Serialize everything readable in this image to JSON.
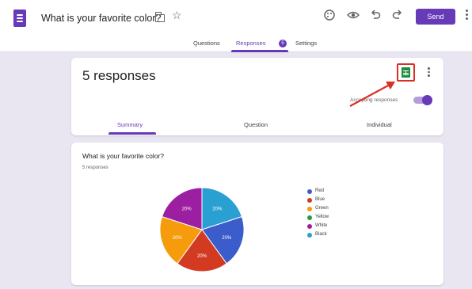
{
  "header": {
    "form_title": "What is your favorite color?",
    "icons": [
      "folder-icon",
      "star-icon",
      "palette-icon",
      "preview-eye-icon",
      "undo-icon",
      "redo-icon",
      "more-vert-icon"
    ],
    "send_label": "Send"
  },
  "tabs": [
    {
      "label": "Questions"
    },
    {
      "label": "Responses",
      "badge": "5"
    },
    {
      "label": "Settings"
    }
  ],
  "responses_card": {
    "title": "5 responses",
    "accepting_label": "Accepting responses",
    "accepting_on": true,
    "sheets_icon": "google-sheets-icon",
    "sub_tabs": [
      "Summary",
      "Question",
      "Individual"
    ]
  },
  "question_card": {
    "title": "What is your favorite color?",
    "count_label": "5 responses"
  },
  "chart_data": {
    "type": "pie",
    "title": "",
    "slices": [
      {
        "label": "Red",
        "value": 20,
        "display": "20%",
        "color": "#d23b22"
      },
      {
        "label": "Blue",
        "value": 20,
        "display": "20%",
        "color": "#3b5dcc"
      },
      {
        "label": "Green",
        "value": 0,
        "display": "",
        "color": "#1e9e4a"
      },
      {
        "label": "Yellow",
        "value": 20,
        "display": "20%",
        "color": "#f59b0c"
      },
      {
        "label": "White",
        "value": 20,
        "display": "20%",
        "color": "#9c1fa1"
      },
      {
        "label": "Black",
        "value": 20,
        "display": "20%",
        "color": "#2a9fd2"
      }
    ],
    "legend_placement": "right",
    "legend": [
      {
        "label": "Red",
        "color": "#3b5dcc"
      },
      {
        "label": "Blue",
        "color": "#d23b22"
      },
      {
        "label": "Green",
        "color": "#f59b0c"
      },
      {
        "label": "Yellow",
        "color": "#1e9e4a"
      },
      {
        "label": "White",
        "color": "#9c1fa1"
      },
      {
        "label": "Black",
        "color": "#2a9fd2"
      }
    ]
  },
  "colors": {
    "accent": "#673ab7",
    "annotation": "#d93025",
    "page_bg": "#e9e6f2"
  }
}
